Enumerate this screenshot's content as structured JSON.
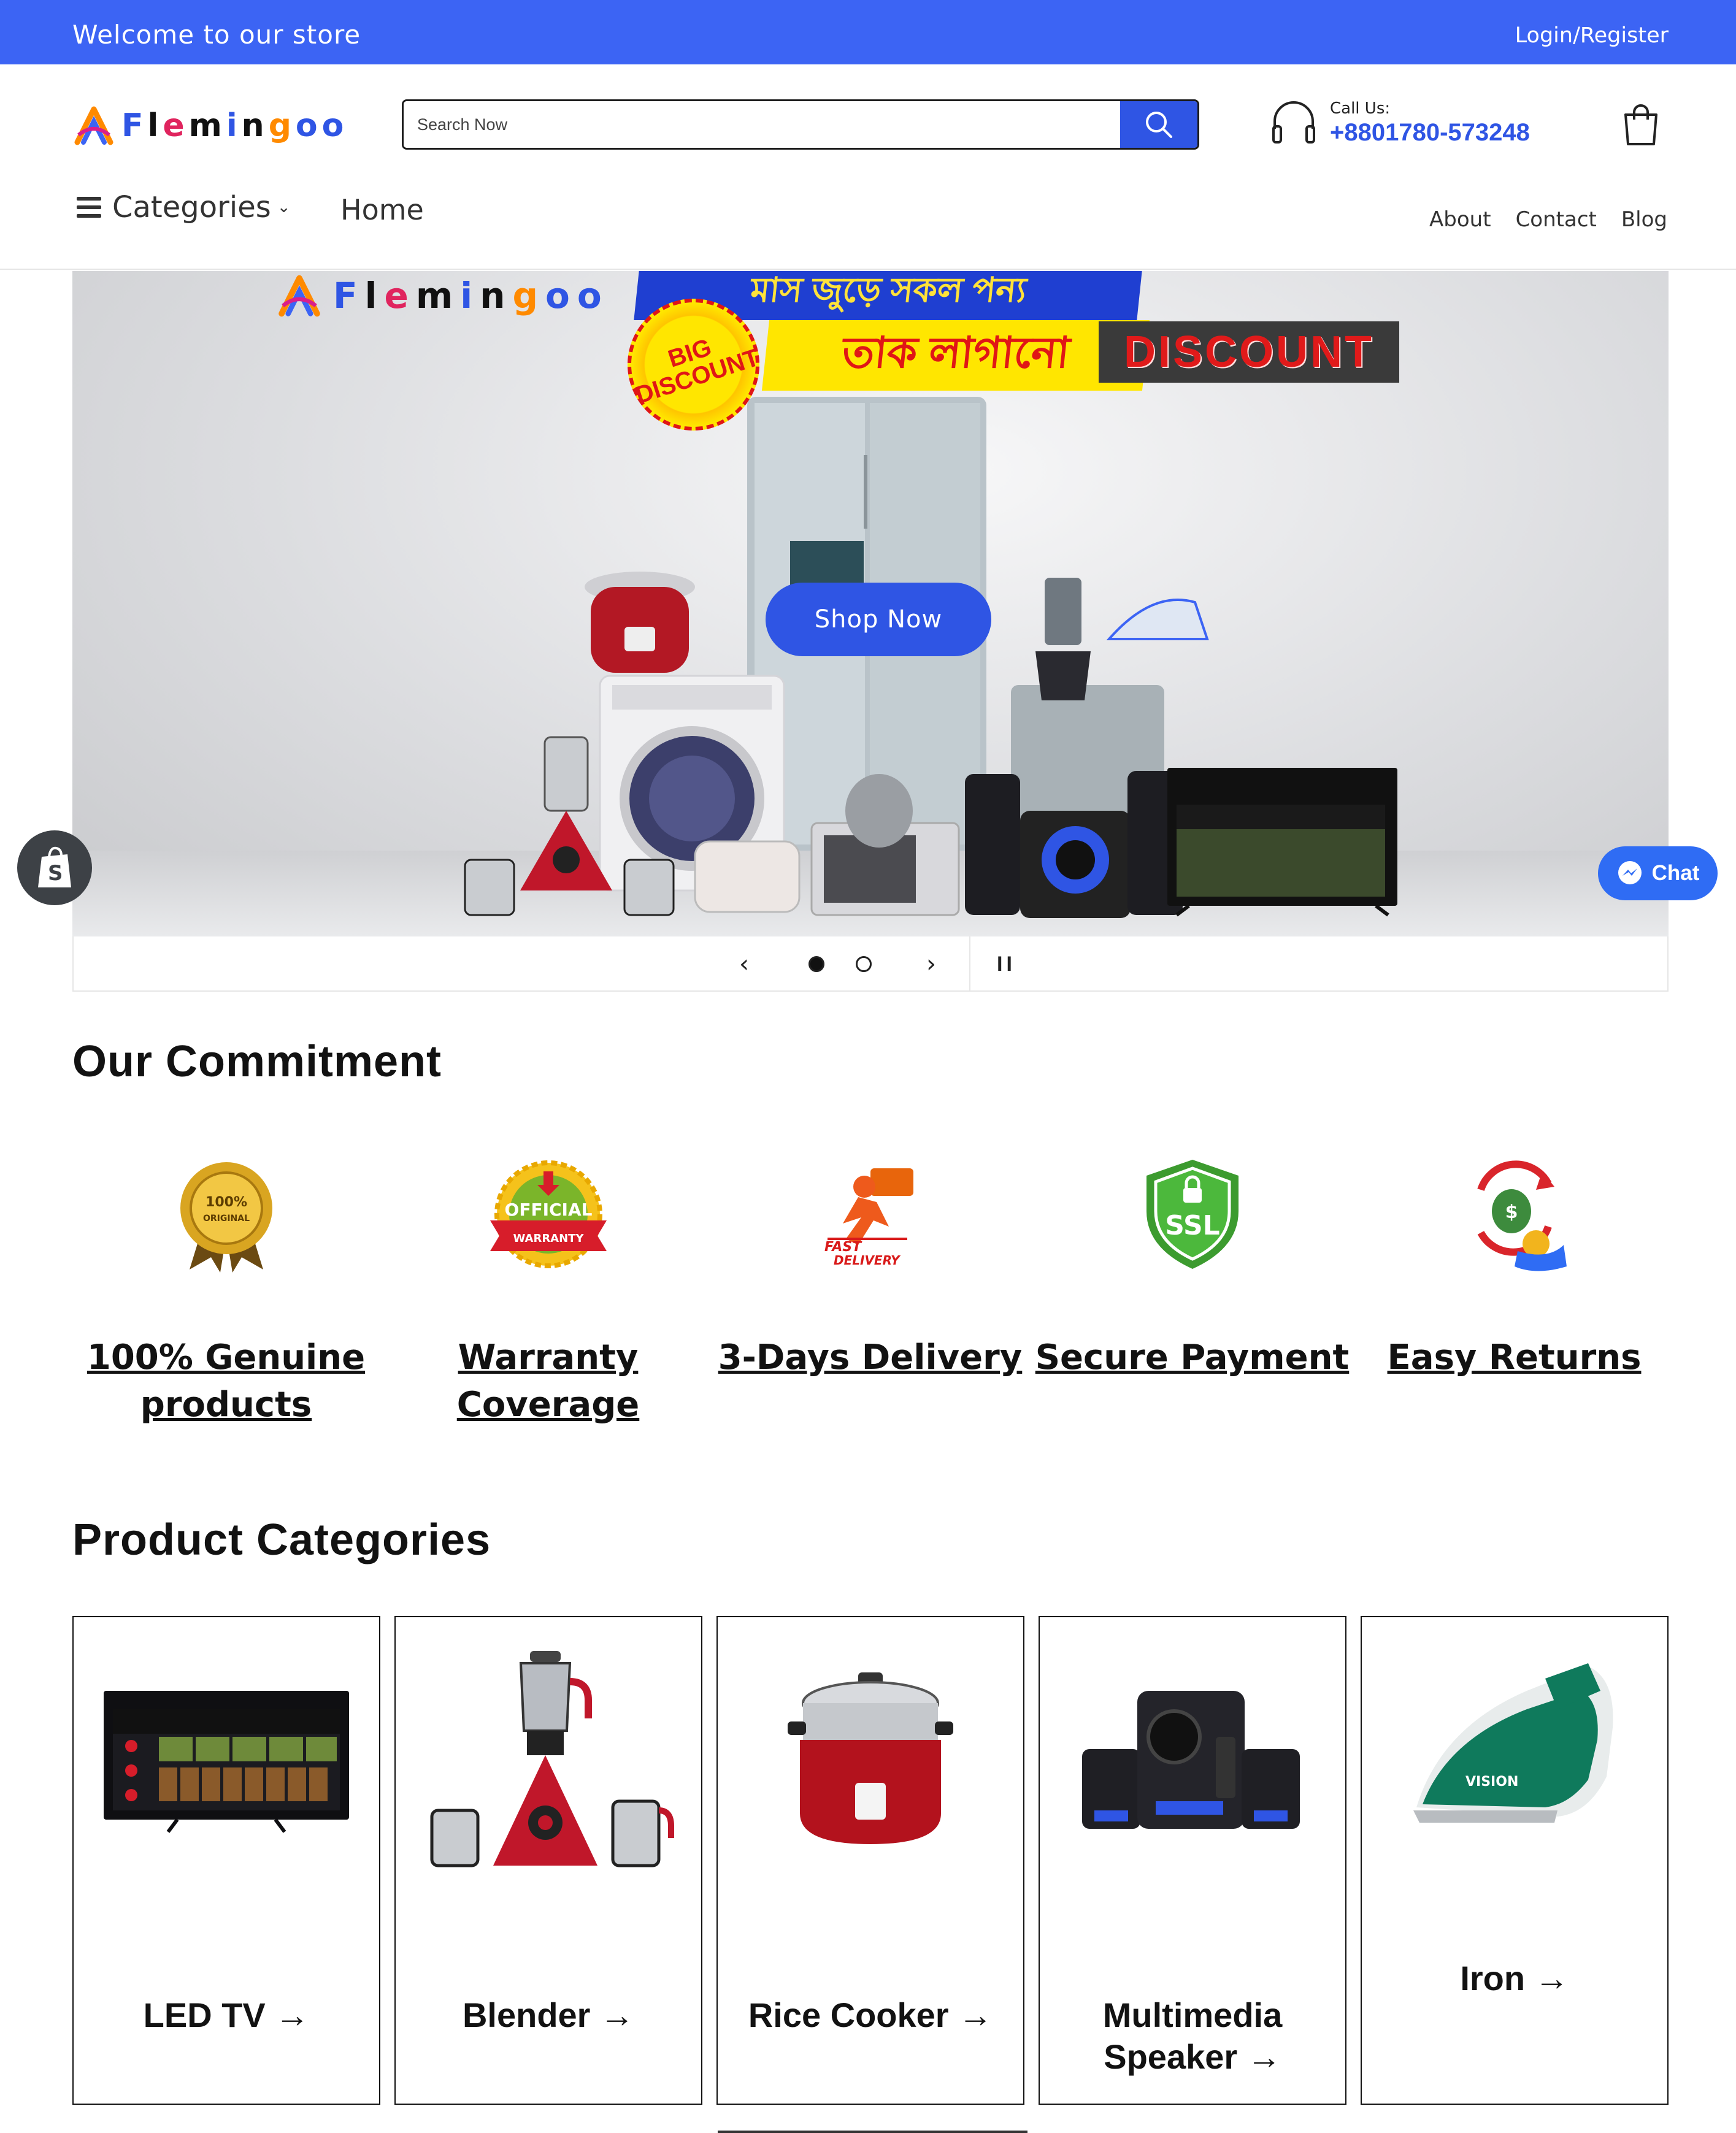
{
  "announcement": {
    "welcome": "Welcome to our store",
    "login": "Login/Register"
  },
  "header": {
    "logo_text": "Flemingoo",
    "search": {
      "placeholder": "Search Now",
      "value": ""
    },
    "call": {
      "label": "Call Us:",
      "number": "+8801780-573248"
    },
    "nav": {
      "categories": "Categories",
      "home": "Home",
      "right": [
        "About",
        "Contact",
        "Blog"
      ]
    }
  },
  "hero": {
    "logo_text": "Flemingoo",
    "banner_top": "মাস জুড়ে সকল পন্য",
    "banner_yellow": "তাক লাগানো",
    "badge": "BIG DISCOUNT",
    "sign": "DISCOUNT",
    "cta": "Shop Now",
    "slides": 2,
    "active_slide": 1
  },
  "floating": {
    "chat": "Chat"
  },
  "commitment": {
    "title": "Our Commitment",
    "items": [
      {
        "label": "100% Genuine products",
        "icon": "genuine-badge-icon",
        "badge_text": "100% ORIGINAL"
      },
      {
        "label": "Warranty Coverage",
        "icon": "warranty-seal-icon",
        "badge_text": "OFFICIAL WARRANTY"
      },
      {
        "label": "3-Days Delivery",
        "icon": "fast-delivery-icon",
        "badge_text": "FAST DELIVERY"
      },
      {
        "label": "Secure Payment",
        "icon": "ssl-shield-icon",
        "badge_text": "SSL"
      },
      {
        "label": "Easy Returns",
        "icon": "money-return-icon",
        "badge_text": ""
      }
    ]
  },
  "categories": {
    "title": "Product Categories",
    "items": [
      {
        "label": "LED TV",
        "icon": "led-tv-icon"
      },
      {
        "label": "Blender",
        "icon": "blender-icon"
      },
      {
        "label": "Rice Cooker",
        "icon": "rice-cooker-icon"
      },
      {
        "label": "Multimedia Speaker",
        "icon": "speaker-icon"
      },
      {
        "label": "Iron",
        "icon": "iron-icon"
      }
    ]
  },
  "colors": {
    "brand_blue": "#3c64f4",
    "button_blue": "#2f55e4",
    "chat_blue": "#2f6cf4",
    "text": "#121212"
  }
}
